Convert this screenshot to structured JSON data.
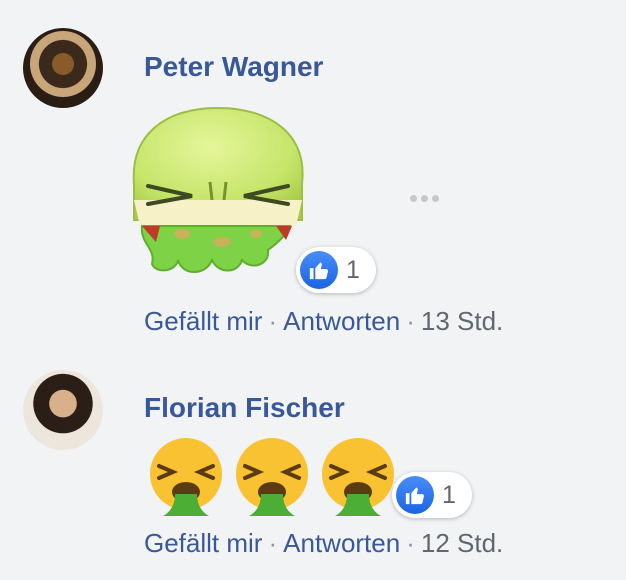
{
  "comments": [
    {
      "author": "Peter Wagner",
      "reaction_count": "1",
      "actions": {
        "like": "Gefällt mir",
        "reply": "Antworten",
        "time": "13 Std."
      }
    },
    {
      "author": "Florian Fischer",
      "reaction_count": "1",
      "actions": {
        "like": "Gefällt mir",
        "reply": "Antworten",
        "time": "12 Std."
      }
    }
  ],
  "separator": "·",
  "icons": {
    "avatar_1": "avatar-photo",
    "sticker": "vomiting-face-sticker",
    "more": "more-options-icon",
    "like": "thumbs-up-icon",
    "emoji": "face-vomiting-emoji"
  },
  "colors": {
    "link": "#385898",
    "meta": "#606770",
    "like": "#1b64e4",
    "background": "#f2f3f5"
  }
}
